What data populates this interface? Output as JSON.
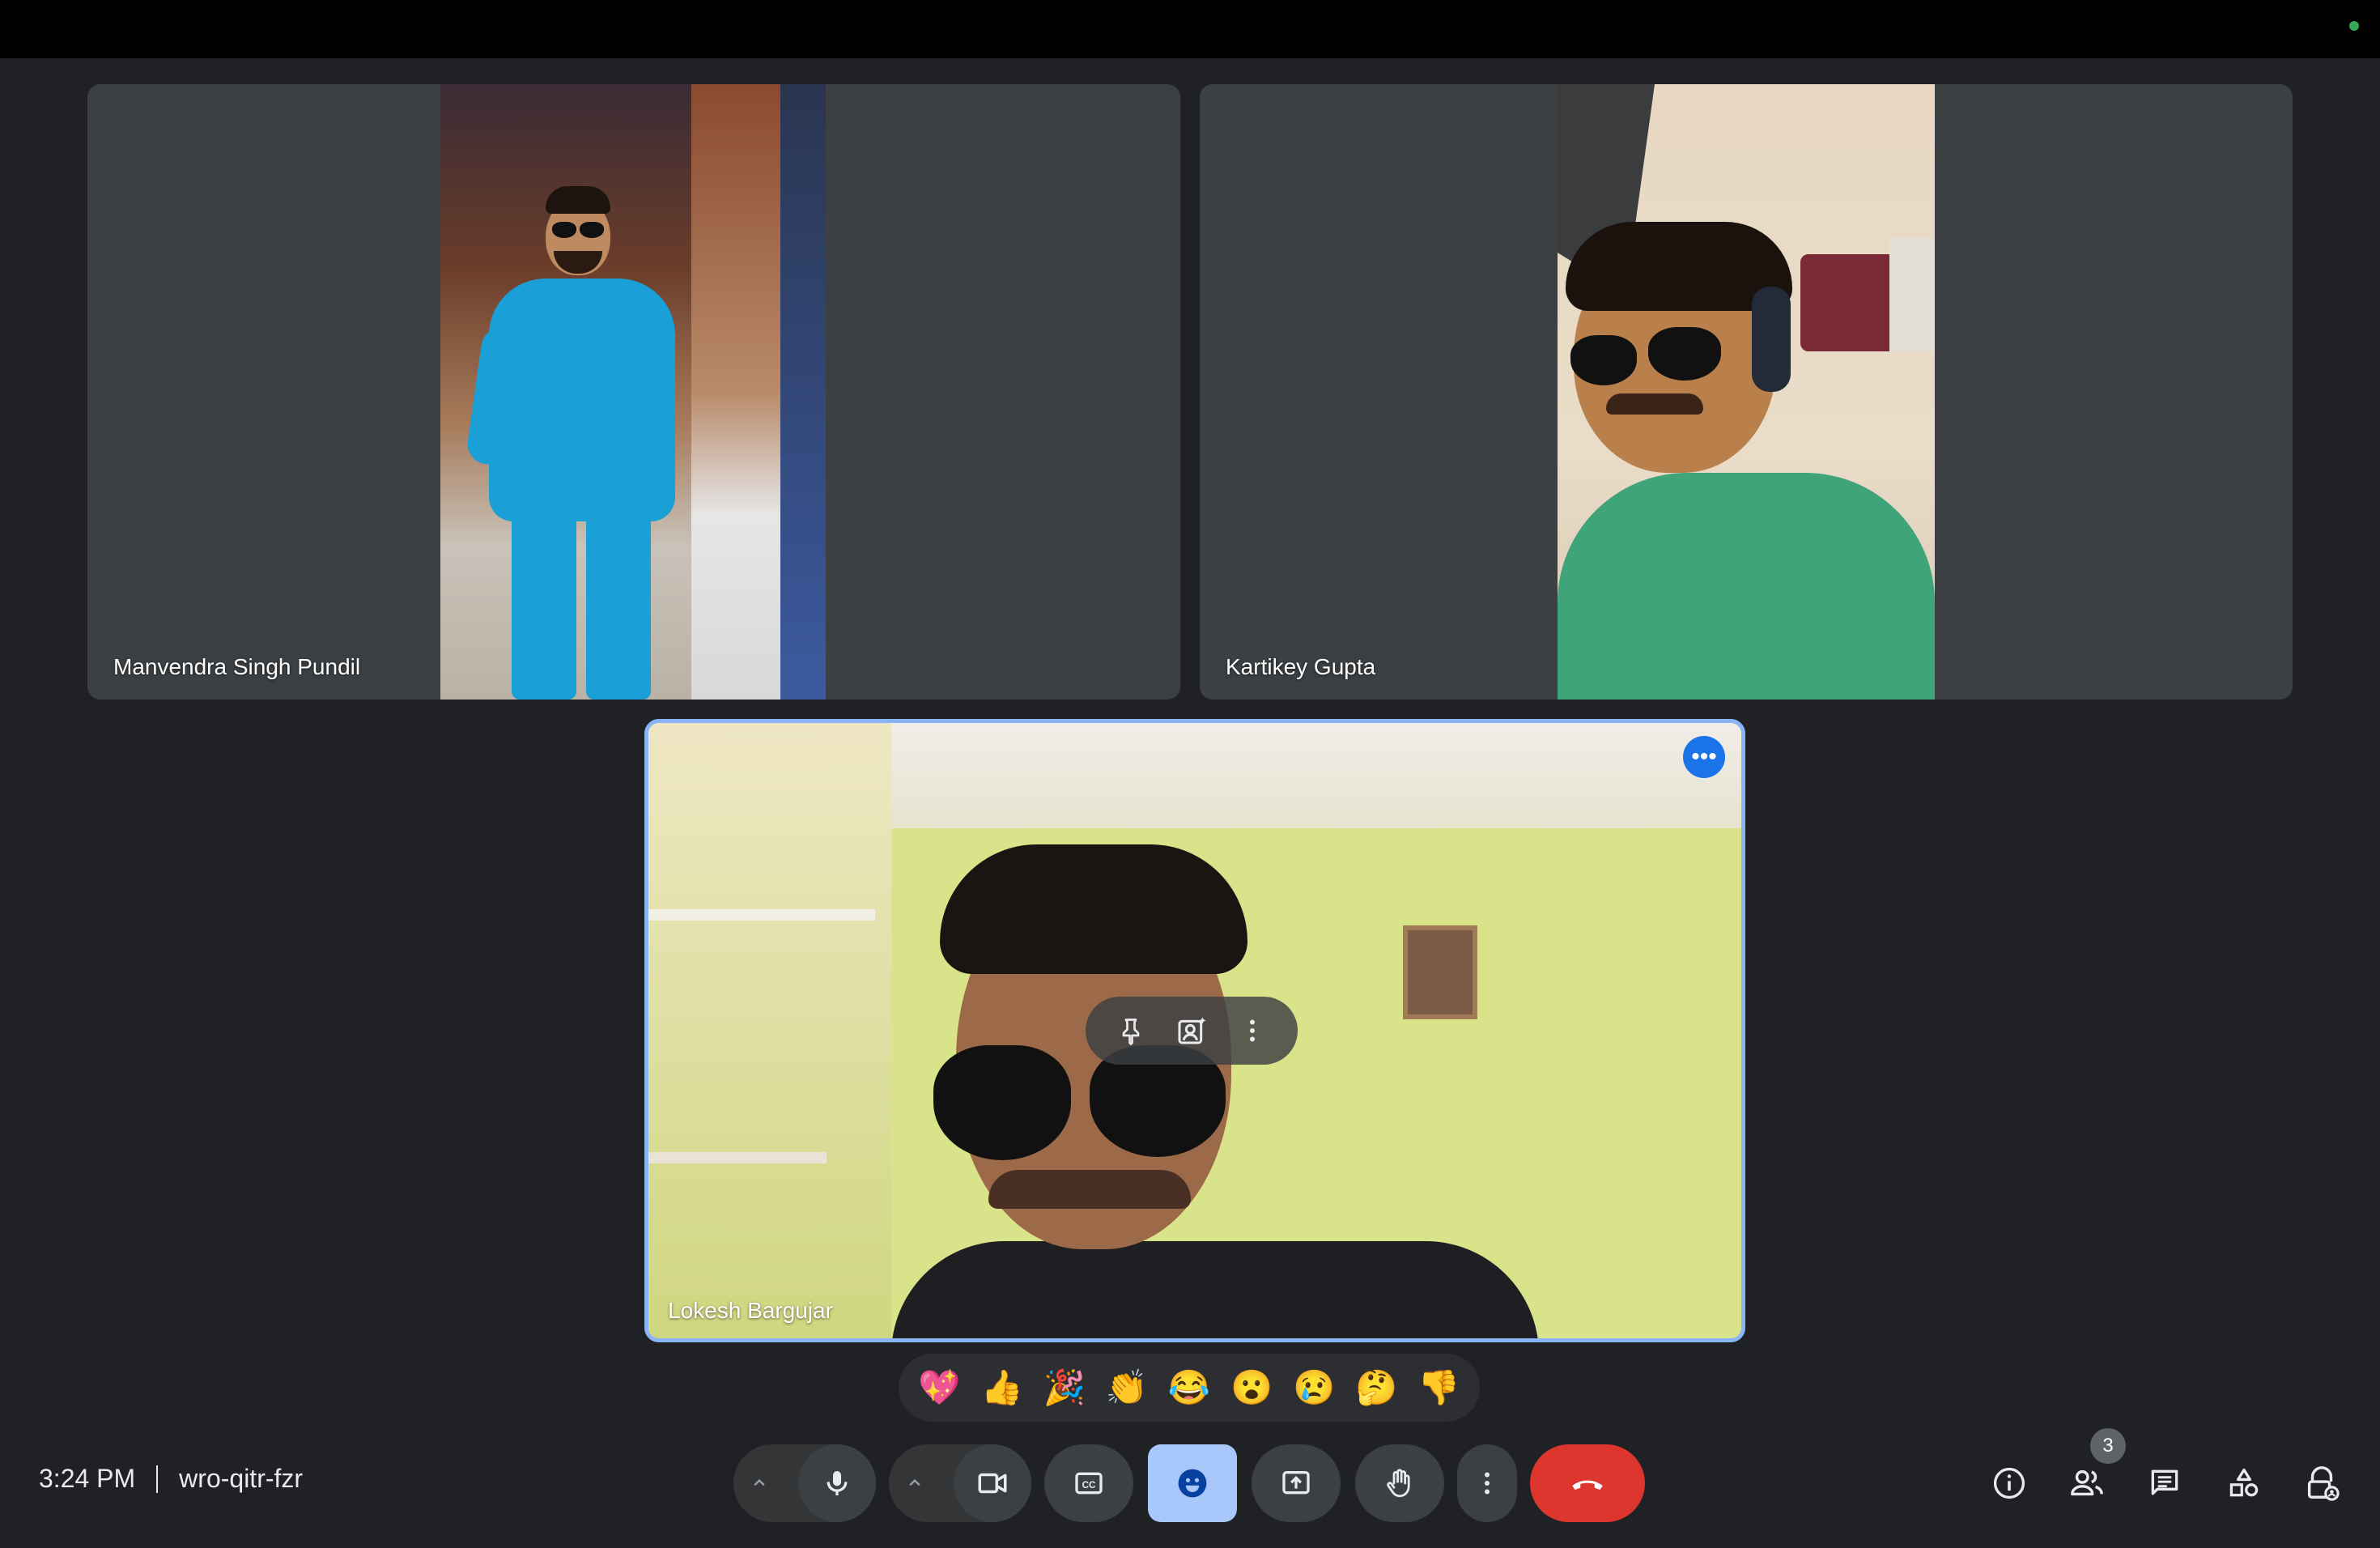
{
  "meeting": {
    "time": "3:24 PM",
    "code": "wro-qitr-fzr",
    "participant_count": "3"
  },
  "participants": [
    {
      "name": "Manvendra Singh Pundil"
    },
    {
      "name": "Kartikey Gupta"
    },
    {
      "name": "Lokesh Bargujar"
    }
  ],
  "reactions": [
    "💖",
    "👍",
    "🎉",
    "👏",
    "😂",
    "😮",
    "😢",
    "🤔",
    "👎"
  ],
  "more_label": "•••",
  "colors": {
    "accent": "#8ab4f8",
    "active_button": "#a8c7fa",
    "leave_button": "#dc362e",
    "background": "#202124",
    "tile": "#3c4043"
  },
  "icons": {
    "tile_hover": [
      "pin-icon",
      "visual-effects-icon",
      "more-vert-icon"
    ],
    "toolbar": [
      "chevron-up-icon",
      "microphone-icon",
      "chevron-up-icon",
      "camera-icon",
      "captions-icon",
      "emoji-icon",
      "present-icon",
      "raise-hand-icon",
      "more-vert-icon",
      "end-call-icon"
    ],
    "right": [
      "info-icon",
      "people-icon",
      "chat-icon",
      "activities-icon",
      "host-controls-icon"
    ]
  }
}
